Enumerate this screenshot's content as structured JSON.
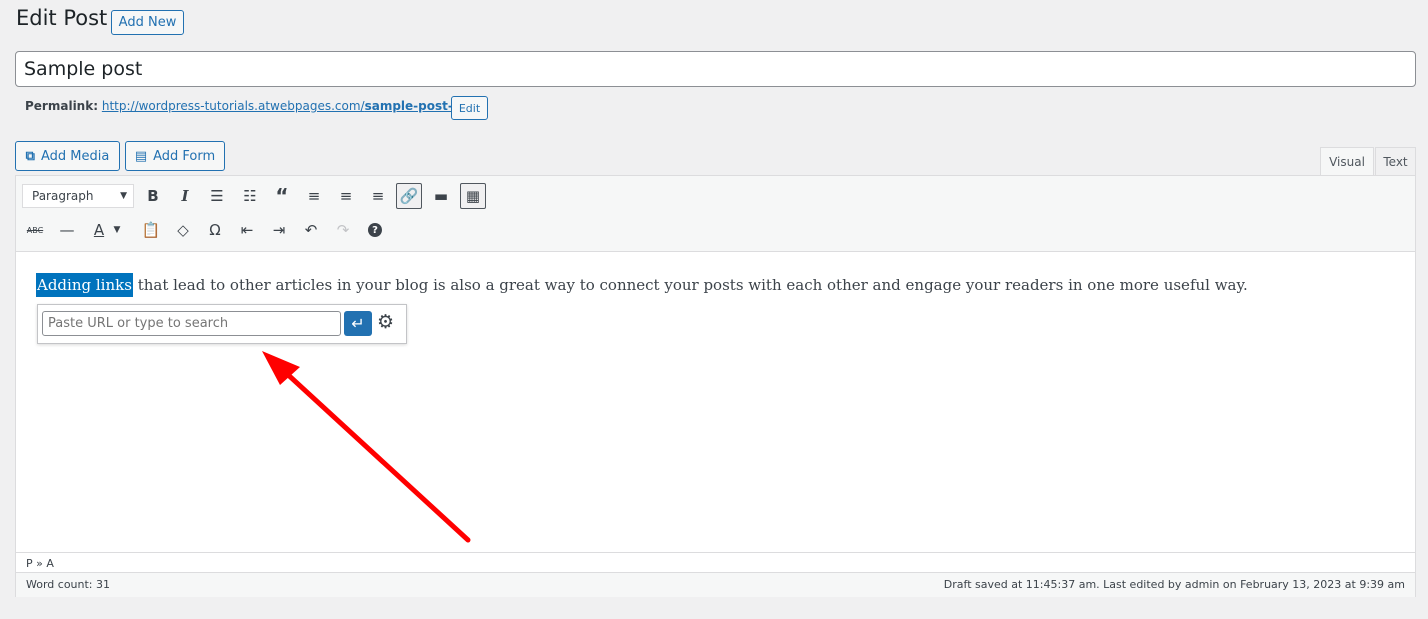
{
  "header": {
    "title": "Edit Post",
    "add_new": "Add New"
  },
  "post_title": "Sample post",
  "permalink": {
    "label": "Permalink:",
    "url_prefix": "http://wordpress-tutorials.atwebpages.com/",
    "slug": "sample-post-test",
    "url_suffix": "/",
    "edit": "Edit"
  },
  "media_buttons": {
    "add_media": "Add Media",
    "add_form": "Add Form"
  },
  "tabs": {
    "visual": "Visual",
    "text": "Text",
    "active": "Visual"
  },
  "toolbar": {
    "format": "Paragraph",
    "abc": "ABC",
    "text_color": "A"
  },
  "content": {
    "selected": "Adding links",
    "rest": " that lead to other articles in your blog is also a great way to connect your posts with each other and engage your readers in one more useful way."
  },
  "link_popup": {
    "placeholder": "Paste URL or type to search"
  },
  "path": "P » A",
  "status": {
    "word_count": "Word count: 31",
    "saved": "Draft saved at 11:45:37 am. Last edited by admin on February 13, 2023 at 9:39 am"
  },
  "annotation": {
    "arrow_color": "#ff0000"
  }
}
